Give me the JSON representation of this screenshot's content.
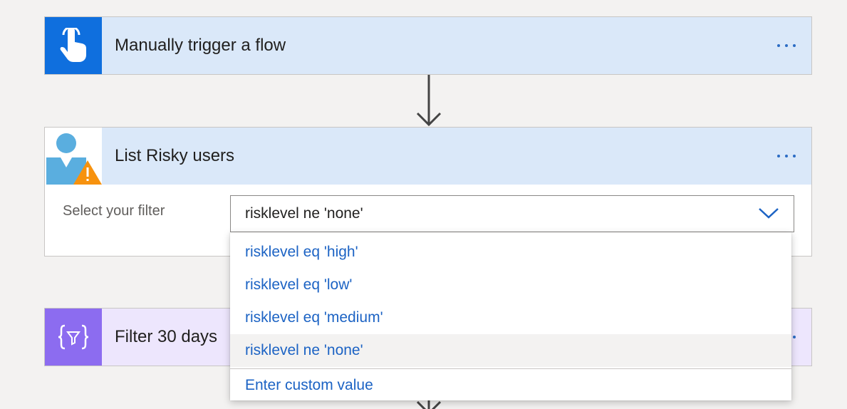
{
  "steps": [
    {
      "title": "Manually trigger a flow",
      "icon": "hand-touch-icon",
      "accent": "#0f6fde",
      "header_bg": "#dae8f9"
    },
    {
      "title": "List Risky users",
      "icon": "risky-user-icon",
      "accent": "#5aaedf",
      "header_bg": "#dae8f9"
    },
    {
      "title": "Filter 30 days",
      "icon": "filter-braces-icon",
      "accent": "#8c6cf0",
      "header_bg": "#ede6fd"
    }
  ],
  "list_risky": {
    "filter_label": "Select your filter",
    "selected_value": "risklevel ne 'none'",
    "options": [
      "risklevel eq 'high'",
      "risklevel eq 'low'",
      "risklevel eq 'medium'",
      "risklevel ne 'none'"
    ],
    "custom_value": "Enter custom value"
  },
  "colors": {
    "link_blue": "#1c63c4",
    "warning_orange": "#f7920e"
  }
}
